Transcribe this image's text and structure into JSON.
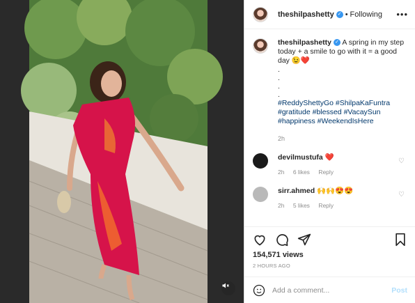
{
  "post": {
    "username": "theshilpashetty",
    "following_label": "Following",
    "more_label": "•••",
    "caption_text": "A spring in my step today + a smile to go with it = a good day 😉❤️",
    "caption_dots": [
      ".",
      ".",
      ".",
      "."
    ],
    "hashtags": "#ReddyShettyGo #ShilpaKaFuntra #gratitude #blessed #VacaySun #happiness #WeekendIsHere",
    "caption_time": "2h",
    "likes": "154,571 views",
    "timestamp": "2 HOURS AGO"
  },
  "comments": [
    {
      "username": "devilmustufa",
      "text": "❤️",
      "time": "2h",
      "likes": "6 likes",
      "reply": "Reply",
      "avatar_color": "#1a1a1a"
    },
    {
      "username": "sirr.ahmed",
      "text": "🙌🙌😍😍",
      "time": "2h",
      "likes": "5 likes",
      "reply": "Reply",
      "avatar_color": "#b9b9b9"
    }
  ],
  "composer": {
    "placeholder": "Add a comment...",
    "post_label": "Post"
  },
  "colors": {
    "link": "#00376b",
    "verified": "#3897f0",
    "post_disabled": "#b2dffc"
  },
  "icons": [
    "heart-icon",
    "comment-icon",
    "share-icon",
    "save-icon",
    "emoji-icon",
    "mute-icon"
  ]
}
